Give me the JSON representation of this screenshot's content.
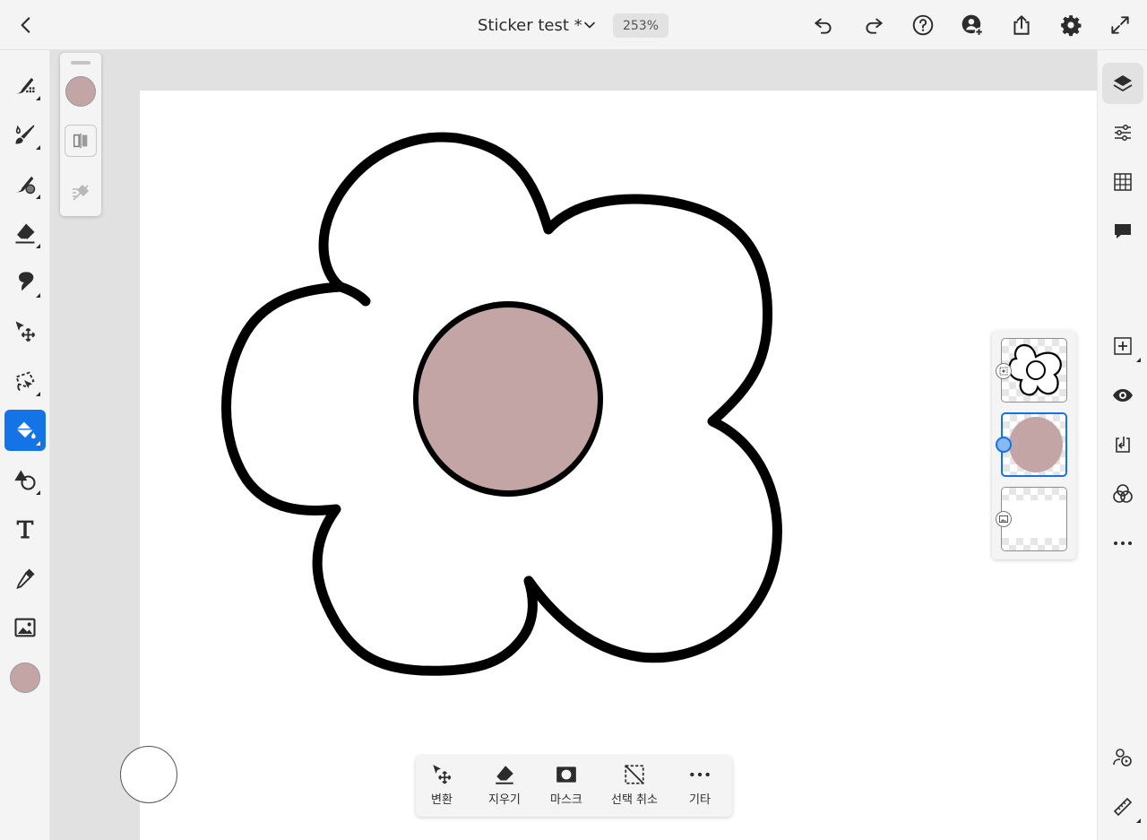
{
  "header": {
    "title": "Sticker test *",
    "zoom": "253%",
    "icons": [
      "back-icon",
      "chevron-down-icon",
      "undo-icon",
      "redo-icon",
      "help-icon",
      "invite-icon",
      "share-icon",
      "settings-icon",
      "fullscreen-icon"
    ]
  },
  "left_toolbar": {
    "tools": [
      "pixel-brush",
      "live-brush",
      "vector-brush",
      "eraser",
      "smudge",
      "move-transform",
      "selection",
      "fill",
      "shapes",
      "type",
      "eyedropper",
      "place-image"
    ],
    "active_tool": "fill",
    "current_color": "#c4a5a6"
  },
  "tool_options": {
    "icons": [
      "color-swatch",
      "fill-mode-icon",
      "fill-sample-icon"
    ]
  },
  "right_rail": {
    "icons": [
      "layers-icon",
      "adjustments-icon",
      "grid-icon",
      "comments-icon",
      "add-layer-icon",
      "visibility-icon",
      "merge-down-icon",
      "blend-mode-icon",
      "more-icon",
      "livestream-icon",
      "ruler-icon"
    ],
    "active": "layers-icon"
  },
  "layers": {
    "count": 3,
    "selected_index": 1
  },
  "taskbar": {
    "transform_label": "변환",
    "erase_label": "지우기",
    "mask_label": "마스크",
    "deselect_label": "선택 취소",
    "more_label": "기타"
  },
  "colors": {
    "accent": "#1473e6",
    "fill_pink": "#c4a5a6",
    "ui_bg": "#f4f4f4",
    "workspace": "#e1e1e1"
  }
}
